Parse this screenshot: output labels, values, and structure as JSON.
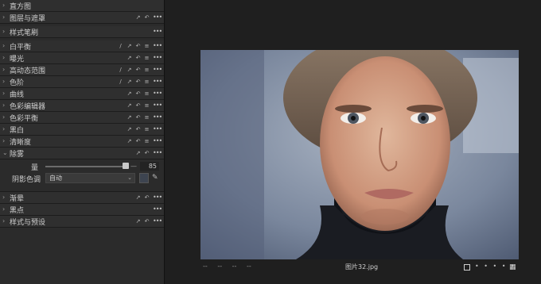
{
  "tools": {
    "histogram": "直方图",
    "layers_masks": "图层与遮罩",
    "style_brushes": "样式笔刷",
    "white_balance": "白平衡",
    "exposure": "曝光",
    "hdr": "高动态范围",
    "levels": "色阶",
    "curves": "曲线",
    "color_editor": "色彩编辑器",
    "color_balance": "色彩平衡",
    "black_white": "黑白",
    "clarity": "清晰度",
    "dehaze": "除雾",
    "vignette": "渐晕",
    "spots": "黑点",
    "styles_presets": "样式与预设"
  },
  "dehaze": {
    "amount_label": "量",
    "amount_value": "85",
    "amount": 85,
    "shadow_tone_label": "阴影色调",
    "shadow_tone_value": "自动",
    "shadow_tone_color": "#3d4450"
  },
  "viewer": {
    "nav_marks": "-- -- -- --",
    "filename": "图片32.jpg",
    "dots": "• • • • •"
  },
  "icons": {
    "chevron": "chevron-right-icon",
    "auto": "auto-adjust-icon",
    "reset": "reset-icon",
    "menu": "more-dots-icon",
    "list": "list-icon",
    "picker": "eyedropper-icon"
  }
}
